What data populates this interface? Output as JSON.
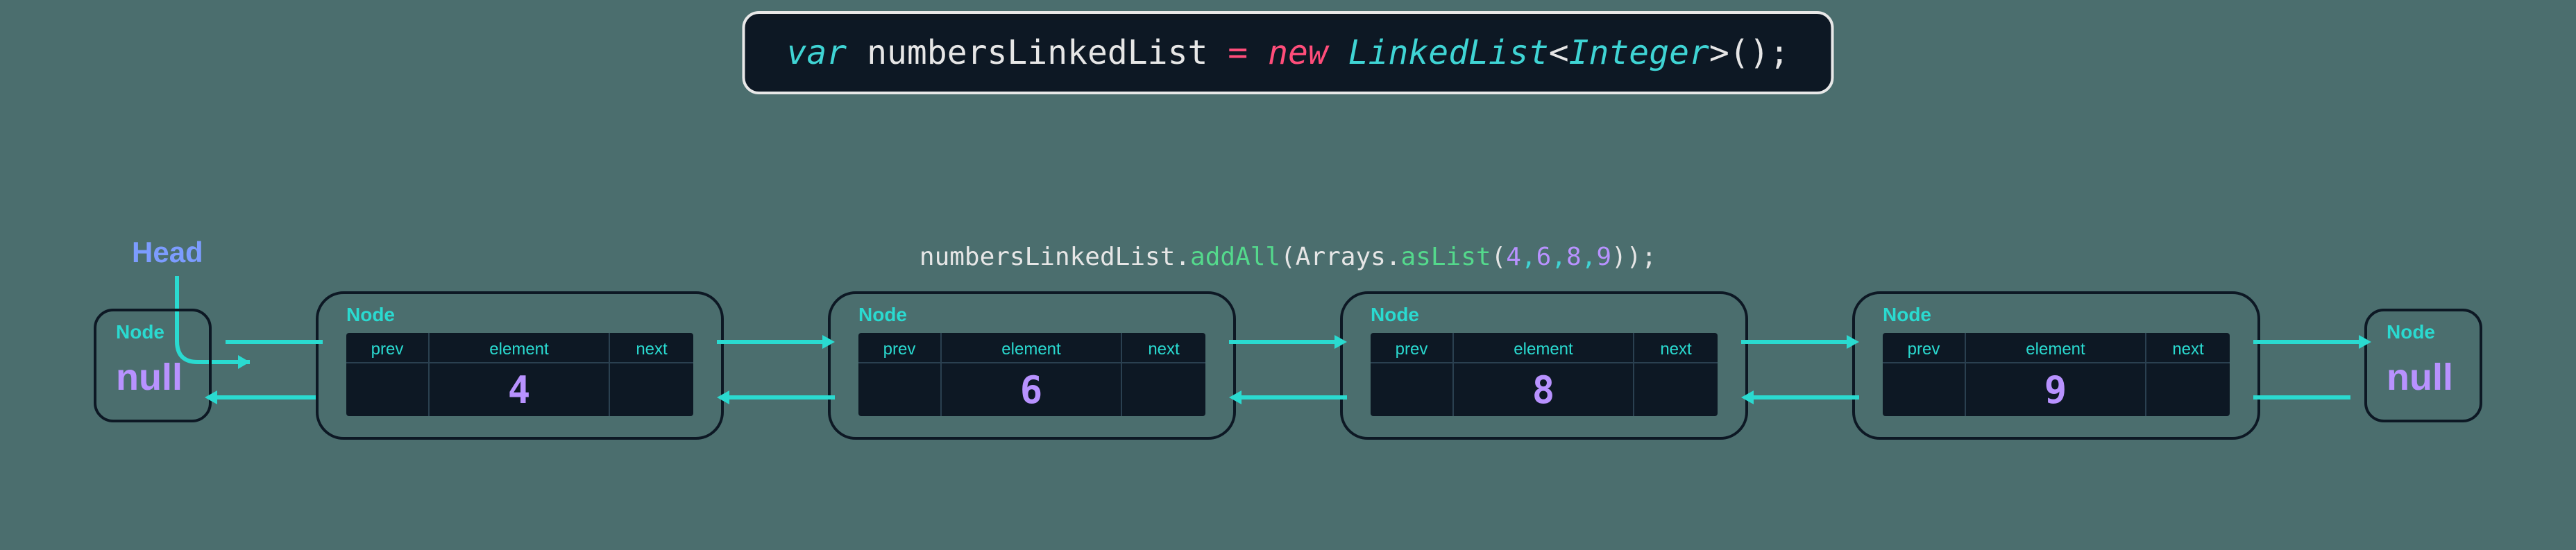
{
  "code": {
    "var": "var",
    "ident": "numbersLinkedList",
    "eq": "=",
    "new": "new",
    "type1": "LinkedList",
    "lt": "<",
    "type2": "Integer",
    "gt": ">",
    "parens": "();"
  },
  "head_label": "Head",
  "method": {
    "obj": "numbersLinkedList",
    "dot1": ".",
    "addAll": "addAll",
    "open": "(",
    "arrays": "Arrays",
    "dot2": ".",
    "asList": "asList",
    "open2": "(",
    "n0": "4",
    "c0": ",",
    "n1": "6",
    "c1": ",",
    "n2": "8",
    "c2": ",",
    "n3": "9",
    "close": "));"
  },
  "labels": {
    "node": "Node",
    "prev": "prev",
    "element": "element",
    "next": "next",
    "null": "null"
  },
  "values": [
    "4",
    "6",
    "8",
    "9"
  ],
  "colors": {
    "bg": "#4b6e6e",
    "box": "#0d1824",
    "teal": "#2adad0",
    "purple": "#b892ff",
    "blue": "#7c9cff",
    "arrow": "#2adad0"
  },
  "chart_data": {
    "type": "table",
    "title": "Doubly linked list diagram",
    "head_pointer": "node[0]",
    "nodes": [
      {
        "prev": null,
        "element": 4,
        "next": "node[1]"
      },
      {
        "prev": "node[0]",
        "element": 6,
        "next": "node[2]"
      },
      {
        "prev": "node[1]",
        "element": 8,
        "next": "node[3]"
      },
      {
        "prev": "node[2]",
        "element": 9,
        "next": null
      }
    ]
  }
}
